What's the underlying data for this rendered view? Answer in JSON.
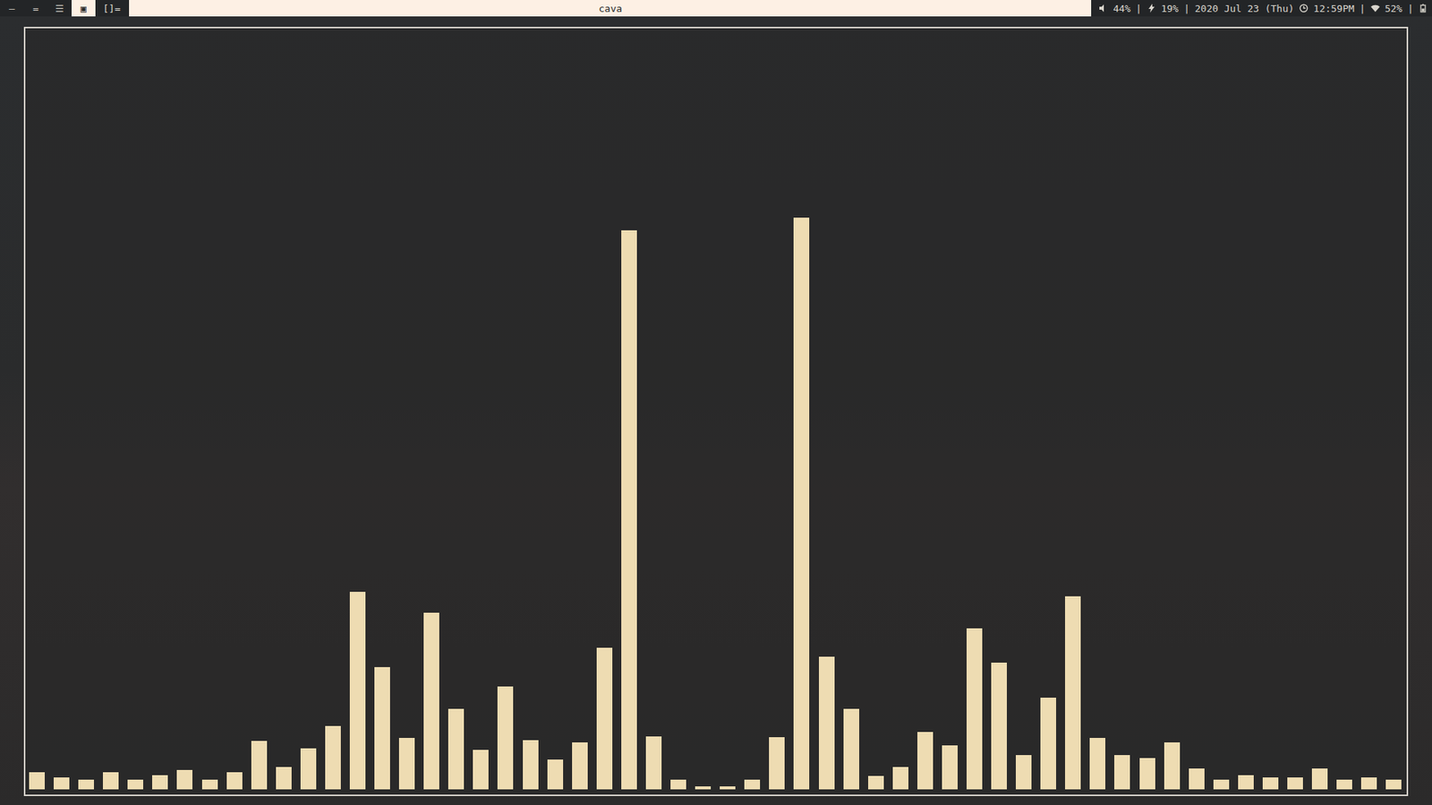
{
  "tags": [
    {
      "label": "—",
      "selected": false
    },
    {
      "label": "=",
      "selected": false
    },
    {
      "label": "☰",
      "selected": false
    },
    {
      "label": "▣",
      "selected": true
    }
  ],
  "layout_symbol": "[]=",
  "window": {
    "title": "cava"
  },
  "status_bar": {
    "volume": "44%",
    "brightness": "19%",
    "date": "2020 Jul 23 (Thu)",
    "time": "12:59PM",
    "wifi": "52%",
    "separator": "|"
  },
  "chart": {
    "values": [
      2.3,
      1.6,
      1.3,
      2.3,
      1.3,
      1.9,
      2.5,
      1.3,
      2.3,
      6.4,
      2.9,
      5.4,
      8.3,
      26.0,
      16.1,
      6.8,
      23.2,
      10.6,
      5.2,
      13.5,
      6.5,
      3.9,
      6.2,
      18.6,
      73.5,
      7.0,
      1.3,
      0.4,
      0.4,
      1.3,
      6.9,
      75.1,
      17.4,
      10.6,
      1.8,
      2.9,
      7.5,
      5.8,
      21.2,
      16.7,
      4.5,
      12.0,
      25.4,
      6.8,
      4.5,
      4.1,
      6.2,
      2.7,
      1.3,
      1.9,
      1.6,
      1.6,
      2.7,
      1.3,
      1.6,
      1.3
    ]
  }
}
